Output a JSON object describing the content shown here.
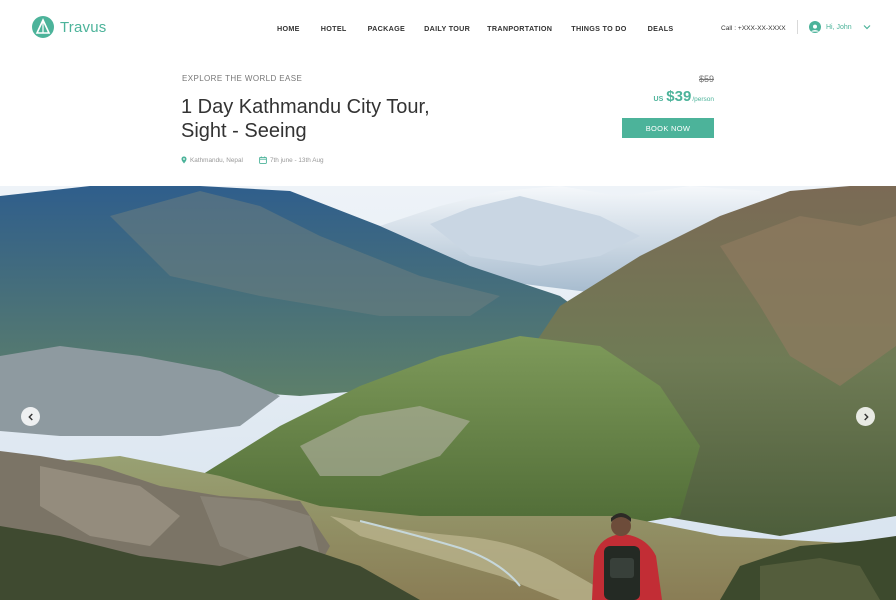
{
  "brand": {
    "name": "Travus",
    "accent": "#4cb39a"
  },
  "nav": {
    "items": [
      "HOME",
      "HOTEL",
      "PACKAGE",
      "DAILY TOUR",
      "TRANPORTATION",
      "THINGS TO DO",
      "DEALS"
    ]
  },
  "header": {
    "call": "Call : +XXX-XX-XXXX",
    "user": "Hi, John"
  },
  "tour": {
    "eyebrow": "EXPLORE THE WORLD EASE",
    "title_line1": "1 Day Kathmandu City Tour,",
    "title_line2": "Sight - Seeing",
    "location": "Kathmandu, Nepal",
    "dates": "7th june - 13th Aug",
    "old_price": "$59",
    "currency": "US",
    "price": "$39",
    "per": "/person",
    "book_label": "BOOK NOW"
  },
  "hero": {
    "icons": {
      "prev": "chevron-left-icon",
      "next": "chevron-right-icon"
    }
  }
}
